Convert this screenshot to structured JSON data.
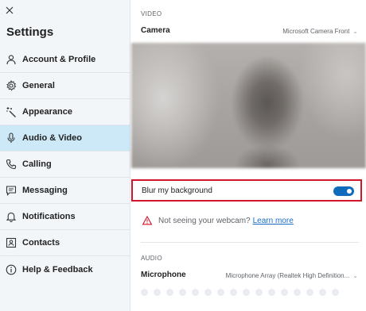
{
  "sidebar": {
    "close_icon": "close-icon",
    "title": "Settings",
    "items": [
      {
        "label": "Account & Profile",
        "icon": "person-icon",
        "active": false
      },
      {
        "label": "General",
        "icon": "gear-icon",
        "active": false
      },
      {
        "label": "Appearance",
        "icon": "magic-wand-icon",
        "active": false
      },
      {
        "label": "Audio & Video",
        "icon": "microphone-icon",
        "active": true
      },
      {
        "label": "Calling",
        "icon": "phone-icon",
        "active": false
      },
      {
        "label": "Messaging",
        "icon": "chat-bubble-icon",
        "active": false
      },
      {
        "label": "Notifications",
        "icon": "bell-icon",
        "active": false
      },
      {
        "label": "Contacts",
        "icon": "contact-card-icon",
        "active": false
      },
      {
        "label": "Help & Feedback",
        "icon": "info-icon",
        "active": false
      }
    ]
  },
  "video": {
    "section_label": "VIDEO",
    "camera_label": "Camera",
    "camera_value": "Microsoft Camera Front",
    "blur_label": "Blur my background",
    "blur_enabled": true,
    "webcam_note": "Not seeing your webcam?",
    "learn_more": "Learn more"
  },
  "audio": {
    "section_label": "AUDIO",
    "microphone_label": "Microphone",
    "microphone_value": "Microphone Array (Realtek High Definition..."
  },
  "colors": {
    "accent": "#0f6cbd",
    "active_nav": "#cde8f7",
    "highlight_border": "#d0162b",
    "link": "#1a6dc2"
  }
}
